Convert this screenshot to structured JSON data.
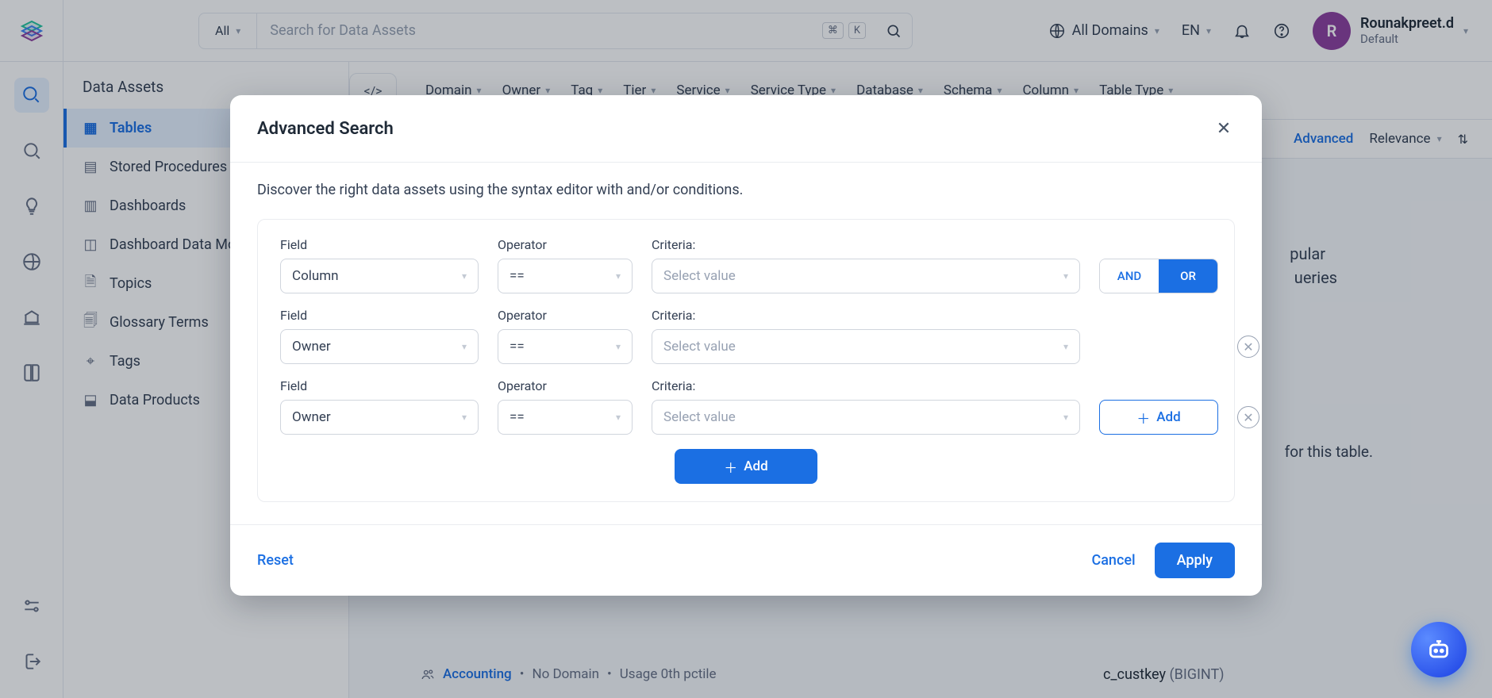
{
  "header": {
    "search_scope": "All",
    "search_placeholder": "Search for Data Assets",
    "kbd_cmd": "⌘",
    "kbd_key": "K",
    "domains_label": "All Domains",
    "lang": "EN",
    "user_initial": "R",
    "user_name": "Rounakpreet.d",
    "user_role": "Default"
  },
  "sidebar": {
    "section_title": "Data Assets",
    "items": [
      {
        "label": "Tables"
      },
      {
        "label": "Stored Procedures"
      },
      {
        "label": "Dashboards"
      },
      {
        "label": "Dashboard Data Mo..."
      },
      {
        "label": "Topics"
      },
      {
        "label": "Glossary Terms"
      },
      {
        "label": "Tags"
      },
      {
        "label": "Data Products"
      }
    ]
  },
  "filters": {
    "items": [
      {
        "label": "Domain"
      },
      {
        "label": "Owner"
      },
      {
        "label": "Tag"
      },
      {
        "label": "Tier"
      },
      {
        "label": "Service"
      },
      {
        "label": "Service Type"
      },
      {
        "label": "Database"
      },
      {
        "label": "Schema"
      },
      {
        "label": "Column"
      },
      {
        "label": "Table Type"
      }
    ],
    "advanced_label": "Advanced",
    "relevance_label": "Relevance"
  },
  "modal": {
    "title": "Advanced Search",
    "description": "Discover the right data assets using the syntax editor with and/or conditions.",
    "labels": {
      "field": "Field",
      "operator": "Operator",
      "criteria": "Criteria:",
      "and": "AND",
      "or": "OR",
      "add": "Add",
      "reset": "Reset",
      "cancel": "Cancel",
      "apply": "Apply",
      "select_value_ph": "Select value"
    },
    "rows": [
      {
        "field": "Column",
        "operator": "=="
      },
      {
        "field": "Owner",
        "operator": "=="
      },
      {
        "field": "Owner",
        "operator": "=="
      }
    ]
  },
  "background": {
    "popular_a": "pular",
    "popular_b": "ueries",
    "for_this_table": "for this table.",
    "accounting": "Accounting",
    "dot": " • ",
    "no_domain": "No Domain",
    "usage": "Usage 0th pctile",
    "c_col": "c_custkey",
    "c_dt": "(BIGINT)"
  }
}
